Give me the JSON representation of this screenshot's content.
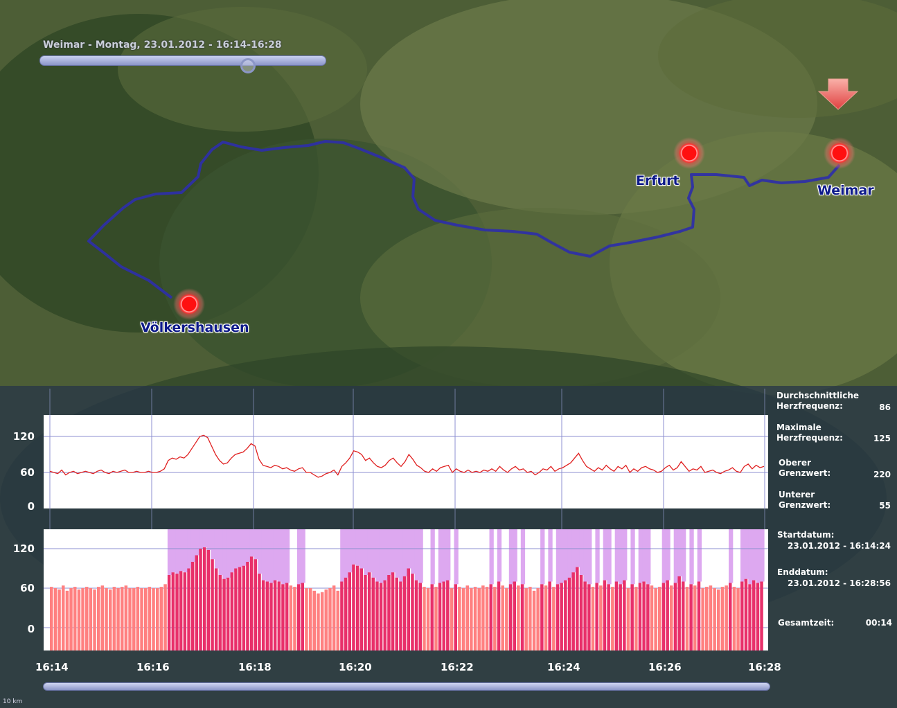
{
  "header": {
    "title": "Weimar - Montag, 23.01.2012 - 16:14-16:28"
  },
  "timeline": {
    "position_fraction": 0.73
  },
  "map": {
    "cities": [
      {
        "name": "Völkershausen"
      },
      {
        "name": "Erfurt"
      },
      {
        "name": "Weimar"
      }
    ],
    "scale_label": "10 km",
    "colors": {
      "route": "#2e2fa8",
      "marker": "#ff1010",
      "arrow": "#f07070"
    }
  },
  "heart_chart": {
    "y_ticks": [
      "120",
      "60",
      "0"
    ]
  },
  "bar_chart": {
    "y_ticks": [
      "120",
      "60",
      "0"
    ]
  },
  "x_ticks": [
    "16:14",
    "16:16",
    "16:18",
    "16:20",
    "16:22",
    "16:24",
    "16:26",
    "16:28"
  ],
  "stats": {
    "avg_label": "Durchschnittliche\nHerzfrequenz:",
    "avg_value": "86",
    "max_label": "Maximale\nHerzfrequenz:",
    "max_value": "125",
    "upper_label": "Oberer\nGrenzwert:",
    "upper_value": "220",
    "lower_label": "Unterer\nGrenzwert:",
    "lower_value": "55",
    "start_label": "Startdatum:",
    "start_value": "23.01.2012 - 16:14:24",
    "end_label": "Enddatum:",
    "end_value": "23.01.2012 - 16:28:56",
    "total_label": "Gesamtzeit:",
    "total_value": "00:14"
  },
  "chart_data": [
    {
      "type": "line",
      "title": "",
      "xlabel": "",
      "ylabel": "",
      "x_range": [
        "16:14",
        "16:28"
      ],
      "ylim": [
        0,
        150
      ],
      "grid": true,
      "series": [
        {
          "color": "#e02020",
          "values": [
            62,
            60,
            58,
            64,
            56,
            60,
            62,
            58,
            60,
            62,
            60,
            58,
            62,
            64,
            60,
            58,
            62,
            60,
            62,
            64,
            60,
            60,
            62,
            60,
            60,
            62,
            60,
            60,
            62,
            66,
            80,
            84,
            82,
            86,
            84,
            90,
            100,
            110,
            120,
            122,
            118,
            104,
            90,
            80,
            74,
            76,
            84,
            90,
            92,
            94,
            100,
            108,
            104,
            82,
            72,
            70,
            68,
            72,
            70,
            66,
            68,
            64,
            62,
            66,
            68,
            60,
            60,
            56,
            52,
            54,
            58,
            60,
            64,
            56,
            70,
            76,
            84,
            96,
            94,
            90,
            80,
            84,
            76,
            70,
            68,
            72,
            80,
            84,
            76,
            70,
            78,
            90,
            82,
            72,
            68,
            62,
            60,
            66,
            62,
            68,
            70,
            72,
            60,
            66,
            62,
            60,
            64,
            60,
            62,
            60,
            64,
            62,
            66,
            62,
            70,
            64,
            60,
            66,
            70,
            64,
            66,
            60,
            62,
            56,
            60,
            66,
            64,
            70,
            62,
            66,
            68,
            72,
            76,
            84,
            92,
            80,
            70,
            66,
            62,
            68,
            64,
            72,
            66,
            62,
            70,
            66,
            72,
            60,
            66,
            62,
            68,
            70,
            66,
            64,
            60,
            62,
            68,
            72,
            64,
            68,
            78,
            70,
            62,
            66,
            64,
            70,
            60,
            62,
            64,
            60,
            58,
            62,
            64,
            68,
            62,
            60,
            70,
            74,
            66,
            72,
            68,
            70
          ]
        }
      ]
    },
    {
      "type": "bar",
      "title": "",
      "xlabel": "",
      "ylabel": "",
      "x_range": [
        "16:14",
        "16:28"
      ],
      "ylim": [
        -30,
        150
      ],
      "grid": true,
      "series": [
        {
          "colors": {
            "bar_low": "#ff8080",
            "bar_high": "#e8306a",
            "above_band": "#dda8f0"
          },
          "values": [
            62,
            60,
            58,
            64,
            56,
            60,
            62,
            58,
            60,
            62,
            60,
            58,
            62,
            64,
            60,
            58,
            62,
            60,
            62,
            64,
            60,
            60,
            62,
            60,
            60,
            62,
            60,
            60,
            62,
            66,
            80,
            84,
            82,
            86,
            84,
            90,
            100,
            110,
            120,
            122,
            118,
            104,
            90,
            80,
            74,
            76,
            84,
            90,
            92,
            94,
            100,
            108,
            104,
            82,
            72,
            70,
            68,
            72,
            70,
            66,
            68,
            64,
            62,
            66,
            68,
            60,
            60,
            56,
            52,
            54,
            58,
            60,
            64,
            56,
            70,
            76,
            84,
            96,
            94,
            90,
            80,
            84,
            76,
            70,
            68,
            72,
            80,
            84,
            76,
            70,
            78,
            90,
            82,
            72,
            68,
            62,
            60,
            66,
            62,
            68,
            70,
            72,
            60,
            66,
            62,
            60,
            64,
            60,
            62,
            60,
            64,
            62,
            66,
            62,
            70,
            64,
            60,
            66,
            70,
            64,
            66,
            60,
            62,
            56,
            60,
            66,
            64,
            70,
            62,
            66,
            68,
            72,
            76,
            84,
            92,
            80,
            70,
            66,
            62,
            68,
            64,
            72,
            66,
            62,
            70,
            66,
            72,
            60,
            66,
            62,
            68,
            70,
            66,
            64,
            60,
            62,
            68,
            72,
            64,
            68,
            78,
            70,
            62,
            66,
            64,
            70,
            60,
            62,
            64,
            60,
            58,
            62,
            64,
            68,
            62,
            60,
            70,
            74,
            66,
            72,
            68,
            70
          ]
        }
      ]
    }
  ]
}
